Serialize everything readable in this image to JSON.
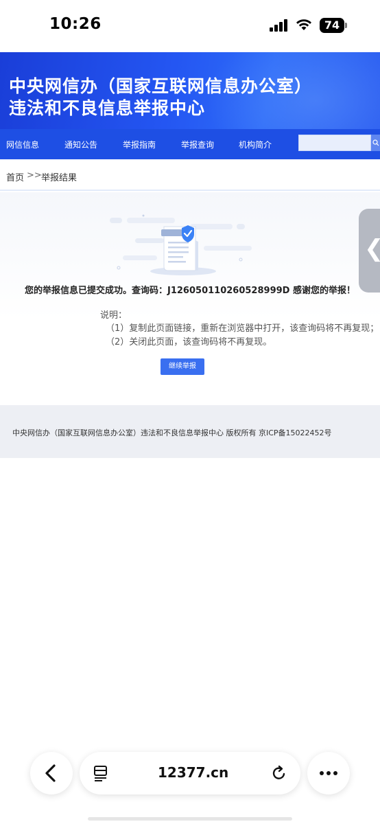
{
  "status_bar": {
    "time": "10:26",
    "battery": "74"
  },
  "header": {
    "title_line1": "中央网信办（国家互联网信息办公室）",
    "title_line2": "违法和不良信息举报中心"
  },
  "nav": {
    "items": [
      "网信信息",
      "通知公告",
      "举报指南",
      "举报查询",
      "机构简介"
    ],
    "search_placeholder": ""
  },
  "breadcrumb": {
    "home": "首页",
    "separator": ">>",
    "current": "举报结果"
  },
  "result": {
    "message": "您的举报信息已提交成功。查询码：J126050110260528999D 感谢您的举报！",
    "note_title": "说明：",
    "notes": [
      "（1）复制此页面链接，重新在浏览器中打开，该查询码将不再复现；",
      "（2）关闭此页面，该查询码将不再复现。"
    ],
    "continue_label": "继续举报"
  },
  "footer": {
    "text": "中央网信办（国家互联网信息办公室）违法和不良信息举报中心 版权所有 京ICP备15022452号"
  },
  "browser": {
    "url": "12377.cn"
  },
  "colors": {
    "brand_blue": "#1e4fe4",
    "button_blue": "#3a6ff0",
    "check_blue": "#3b82f6"
  }
}
